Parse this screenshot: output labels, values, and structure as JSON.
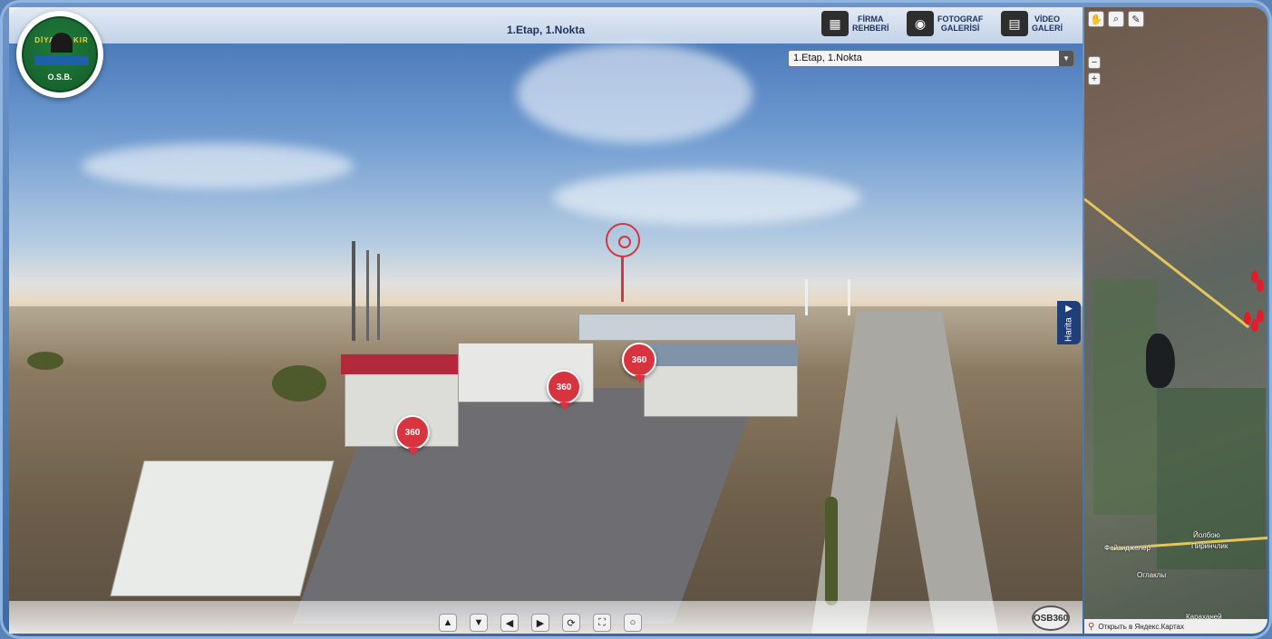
{
  "header": {
    "title": "1.Etap, 1.Nokta"
  },
  "logo": {
    "ring_text": "DİYARBAKIR",
    "subtitle": "O.S.B."
  },
  "top_buttons": [
    {
      "icon": "building-icon",
      "line1": "FİRMA",
      "line2": "REHBERİ"
    },
    {
      "icon": "camera-icon",
      "line1": "FOTOGRAF",
      "line2": "GALERİSİ"
    },
    {
      "icon": "film-icon",
      "line1": "VİDEO",
      "line2": "GALERİ"
    }
  ],
  "location_select": {
    "value": "1.Etap, 1.Nokta"
  },
  "hotspots": [
    {
      "label": "360"
    },
    {
      "label": "360"
    },
    {
      "label": "360"
    }
  ],
  "side_tab": {
    "label": "Harita"
  },
  "nav_controls": [
    "up-arrow-icon",
    "down-arrow-icon",
    "left-arrow-icon",
    "right-arrow-icon",
    "autorotate-icon",
    "fullscreen-icon",
    "refresh-icon"
  ],
  "brand_badge": "OSB360",
  "map": {
    "zoom_out": "−",
    "zoom_in": "+",
    "labels": [
      "Йолбою",
      "Пиринчлик",
      "Фейзиджелер",
      "Оглаклы",
      "Караханей"
    ],
    "footer_link": "Открыть в Яндекс.Картах"
  }
}
